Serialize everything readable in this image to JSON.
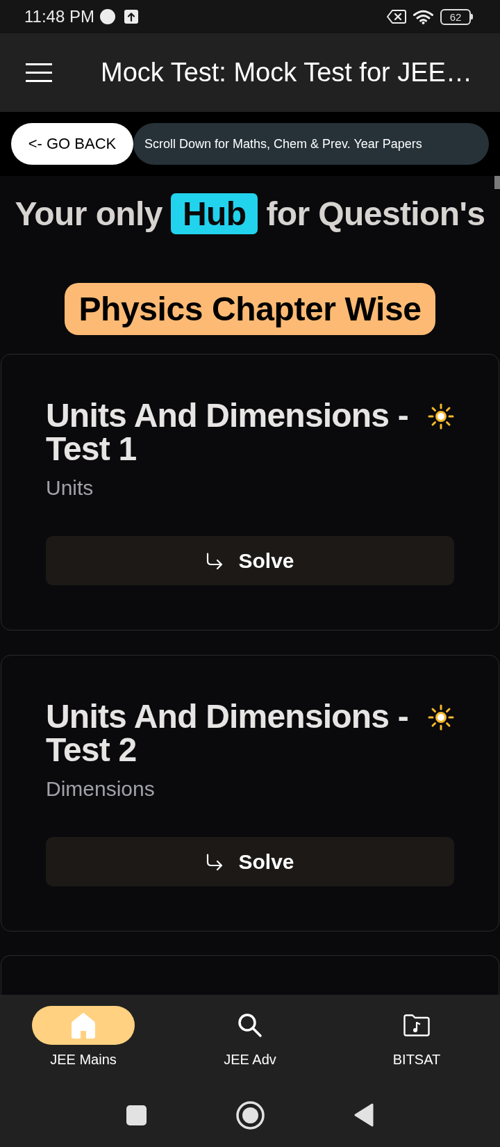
{
  "status_bar": {
    "time": "11:48 PM",
    "battery": "62"
  },
  "header": {
    "title": "Mock Test: Mock Test for JEE…"
  },
  "actions": {
    "back_button": "<- GO BACK",
    "banner": "Scroll Down for Maths, Chem & Prev. Year Papers"
  },
  "hero": {
    "before": "Your only",
    "highlight": "Hub",
    "after": "for Question's"
  },
  "section": {
    "title": "Physics Chapter Wise"
  },
  "tests": [
    {
      "title": "Units And Dimensions - Test 1",
      "topic": "Units",
      "button": "Solve"
    },
    {
      "title": "Units And Dimensions - Test 2",
      "topic": "Dimensions",
      "button": "Solve"
    }
  ],
  "bottom_nav": {
    "items": [
      {
        "label": "JEE Mains",
        "selected": true
      },
      {
        "label": "JEE Adv",
        "selected": false
      },
      {
        "label": "BITSAT",
        "selected": false
      }
    ]
  }
}
